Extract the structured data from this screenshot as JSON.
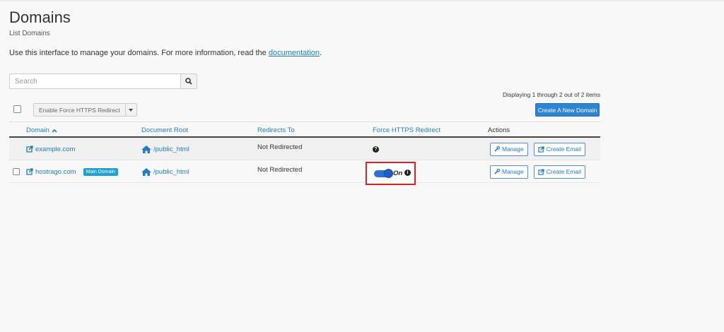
{
  "header": {
    "title": "Domains",
    "subtitle": "List Domains",
    "intro_text": "Use this interface to manage your domains. For more information, read the ",
    "intro_link": "documentation",
    "intro_end": "."
  },
  "search": {
    "placeholder": "Search",
    "value": ""
  },
  "pagination": {
    "text": "Displaying 1 through 2 out of 2 items"
  },
  "toolbar": {
    "bulk_action": "Enable Force HTTPS Redirect",
    "create_label": "Create A New Domain"
  },
  "table": {
    "columns": {
      "domain": "Domain",
      "document_root": "Document Root",
      "redirects_to": "Redirects To",
      "force_https": "Force HTTPS Redirect",
      "actions": "Actions"
    },
    "rows": [
      {
        "domain": "example.com",
        "badge": "",
        "document_root": "/public_html",
        "redirects_to": "Not Redirected",
        "force_https": "",
        "manage": "Manage",
        "create_email": "Create Email"
      },
      {
        "domain": "hostrago.com",
        "badge": "Main Domain",
        "document_root": "/public_html",
        "redirects_to": "Not Redirected",
        "force_https": "On",
        "manage": "Manage",
        "create_email": "Create Email"
      }
    ]
  },
  "colors": {
    "link": "#1f7dc2",
    "primary_button": "#2d84d2",
    "badge": "#1fa1d4",
    "highlight_border": "#e02020",
    "toggle_on": "#2d6fd2"
  },
  "icons": [
    "search-icon",
    "sort-up-icon",
    "external-link-icon",
    "home-icon",
    "wrench-icon",
    "help-icon",
    "info-icon",
    "caret-down-icon"
  ]
}
